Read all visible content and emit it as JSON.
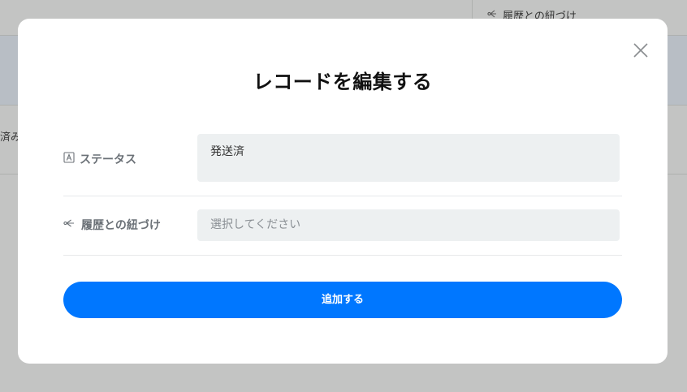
{
  "background": {
    "header_column_label": "履歴との紐づけ",
    "partial_cell_text": "済み"
  },
  "modal": {
    "title": "レコードを編集する",
    "close_icon": "close-icon",
    "fields": [
      {
        "label": "ステータス",
        "icon": "text-field-icon",
        "value": "発送済",
        "placeholder": ""
      },
      {
        "label": "履歴との紐づけ",
        "icon": "link-relation-icon",
        "value": "",
        "placeholder": "選択してください"
      }
    ],
    "submit_label": "追加する"
  },
  "colors": {
    "accent": "#0077ff",
    "overlay": "#c3c4c3",
    "input_bg": "#edf0f1",
    "label_text": "#6b7177"
  }
}
